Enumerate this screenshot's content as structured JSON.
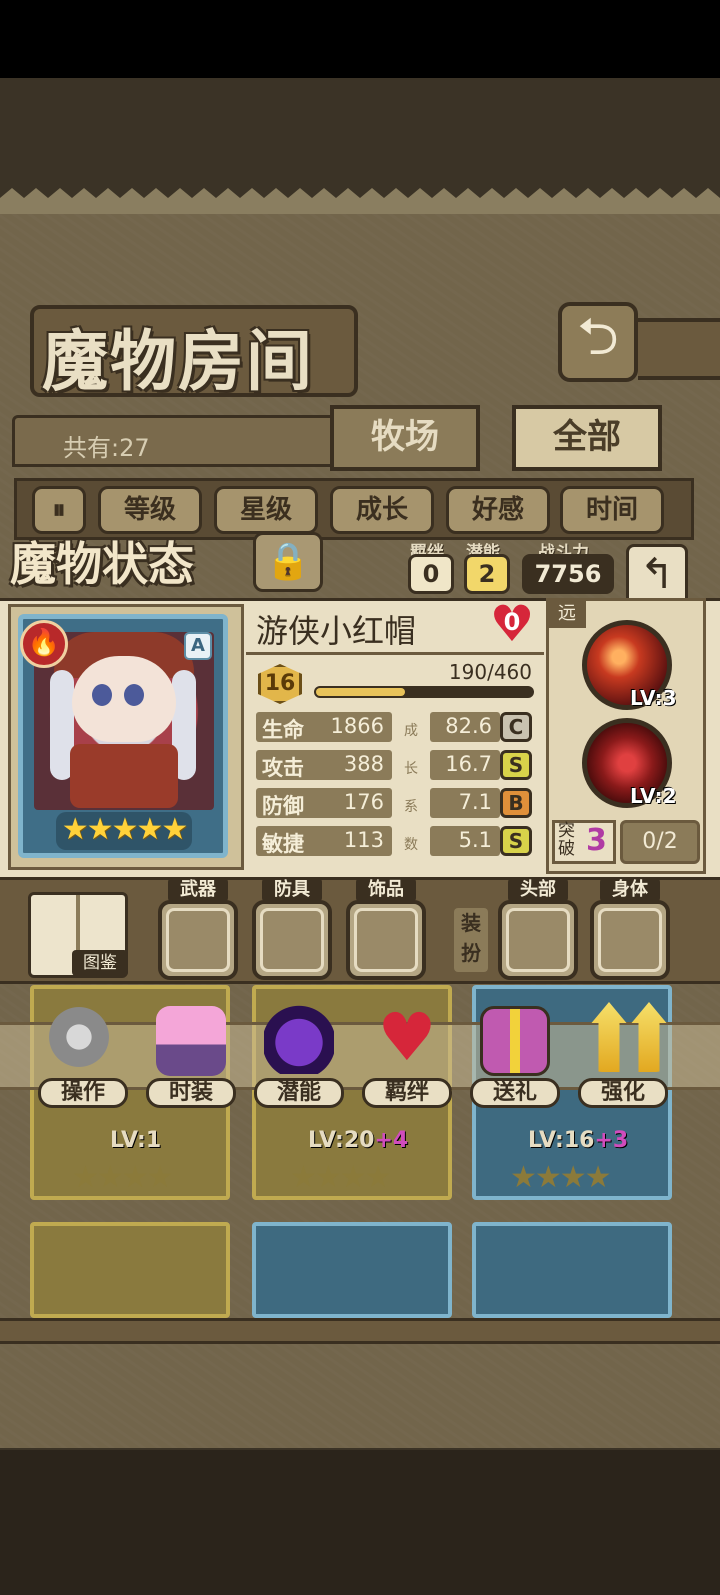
{
  "screen": {
    "title": "魔物房间",
    "back_glyph": "⮌"
  },
  "roster_header": {
    "count_label": "共有:27",
    "tabs": [
      "牧场",
      "全部"
    ],
    "active_tab": "全部"
  },
  "filters": {
    "toggle_glyph": "⏸",
    "buttons": [
      "等级",
      "星级",
      "成长",
      "好感",
      "时间"
    ]
  },
  "status": {
    "title": "魔物状态",
    "lock_glyph": "🔒",
    "bond_label": "羁绊",
    "bond_value": "0",
    "potential_label": "潜能",
    "potential_value": "2",
    "power_label": "战斗力",
    "power_value": "7756",
    "close_glyph": "↰"
  },
  "monster": {
    "name": "游侠小红帽",
    "affinity": "0",
    "element_glyph": "🔥",
    "rank": "A",
    "stars": "★★★★★",
    "star_count": 5,
    "level": "16",
    "exp_text": "190/460",
    "exp_fraction": 0.413,
    "stats": [
      {
        "label": "生命",
        "value": "1866",
        "growth": "82.6",
        "grade": "C",
        "grade_color": "#c9c2b0"
      },
      {
        "label": "攻击",
        "value": "388",
        "growth": "16.7",
        "grade": "S",
        "grade_color": "#d8d24a"
      },
      {
        "label": "防御",
        "value": "176",
        "growth": "7.1",
        "grade": "B",
        "grade_color": "#e0903a"
      },
      {
        "label": "敏捷",
        "value": "113",
        "growth": "5.1",
        "grade": "S",
        "grade_color": "#d8d24a"
      }
    ],
    "growth_chars": [
      "成",
      "长",
      "系",
      "数"
    ]
  },
  "skills": {
    "range_tag": "远",
    "items": [
      {
        "lv": "LV:3"
      },
      {
        "lv": "LV:2"
      }
    ],
    "break_label": "突破",
    "break_value": "3",
    "break_progress": "0/2"
  },
  "equipment": {
    "codex_label": "图鉴",
    "slots": [
      "武器",
      "防具",
      "饰品",
      "头部",
      "身体"
    ],
    "dress_label": "装扮"
  },
  "actions": [
    "操作",
    "时装",
    "潜能",
    "羁绊",
    "送礼",
    "强化"
  ],
  "roster": [
    {
      "lv": "LV:1",
      "plus": ""
    },
    {
      "lv": "LV:20",
      "plus": "+4"
    },
    {
      "lv": "LV:16",
      "plus": "+3"
    }
  ],
  "roster_stars": "★★★★"
}
